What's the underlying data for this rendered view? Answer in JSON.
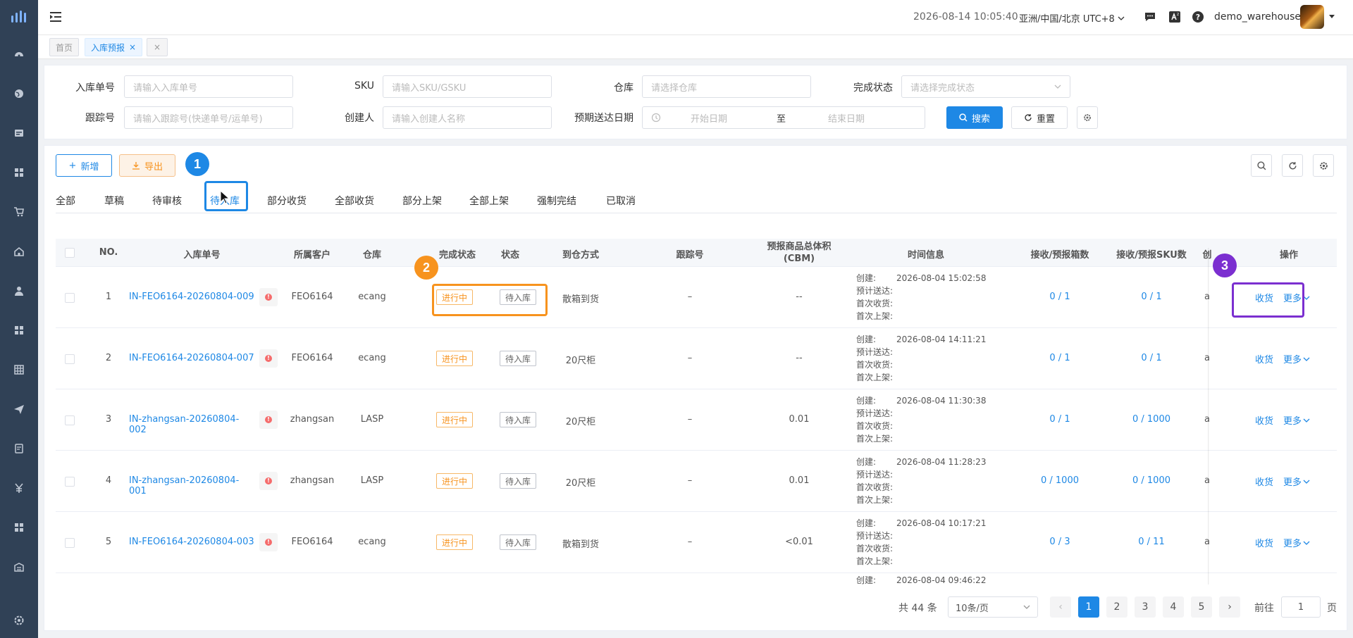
{
  "topbar": {
    "datetime": "2026-08-14 10:05:40",
    "timezone": "亚洲/中国/北京 UTC+8",
    "username": "demo_warehouse"
  },
  "tags": [
    {
      "label": "首页"
    },
    {
      "label": "入库预报"
    }
  ],
  "filters": {
    "inbound_no": {
      "label": "入库单号",
      "placeholder": "请输入入库单号"
    },
    "sku": {
      "label": "SKU",
      "placeholder": "请输入SKU/GSKU"
    },
    "warehouse": {
      "label": "仓库",
      "placeholder": "请选择仓库"
    },
    "finish_status": {
      "label": "完成状态",
      "placeholder": "请选择完成状态"
    },
    "tracking": {
      "label": "跟踪号",
      "placeholder": "请输入跟踪号(快递单号/运单号)"
    },
    "creator": {
      "label": "创建人",
      "placeholder": "请输入创建人名称"
    },
    "eta": {
      "label": "预期送达日期",
      "start": "开始日期",
      "to": "至",
      "end": "结束日期"
    },
    "search_label": "搜索",
    "reset_label": "重置"
  },
  "toolbar": {
    "add_label": "新增",
    "export_label": "导出"
  },
  "tabs": [
    "全部",
    "草稿",
    "待审核",
    "待入库",
    "部分收货",
    "全部收货",
    "部分上架",
    "全部上架",
    "强制完结",
    "已取消"
  ],
  "active_tab": "待入库",
  "annotations": {
    "badge1": "1",
    "badge2": "2",
    "badge3": "3"
  },
  "table": {
    "headers": {
      "no": "NO.",
      "inbound_no": "入库单号",
      "customer": "所属客户",
      "warehouse": "仓库",
      "finish_status": "完成状态",
      "status": "状态",
      "arrival": "到仓方式",
      "tracking": "跟踪号",
      "volume_l1": "预报商品总体积",
      "volume_l2": "(CBM)",
      "time": "时间信息",
      "boxes": "接收/预报箱数",
      "skus": "接收/预报SKU数",
      "partial": "创",
      "ops": "操作"
    },
    "time_labels": {
      "created": "创建:",
      "eta": "预计送达:",
      "first_receive": "首次收货:",
      "first_shelf": "首次上架:"
    },
    "rows": [
      {
        "no": "1",
        "inbound_no": "IN-FEO6164-20260804-009",
        "customer": "FEO6164",
        "warehouse": "ecang",
        "finish_status": "进行中",
        "status": "待入库",
        "arrival": "散箱到货",
        "tracking": "–",
        "volume": "--",
        "created": "2026-08-04 15:02:58",
        "boxes": "0 / 1",
        "skus": "0 / 1",
        "partial": "a",
        "receive": "收货",
        "more": "更多"
      },
      {
        "no": "2",
        "inbound_no": "IN-FEO6164-20260804-007",
        "customer": "FEO6164",
        "warehouse": "ecang",
        "finish_status": "进行中",
        "status": "待入库",
        "arrival": "20尺柜",
        "tracking": "–",
        "volume": "--",
        "created": "2026-08-04 14:11:21",
        "boxes": "0 / 1",
        "skus": "0 / 1",
        "partial": "a",
        "receive": "收货",
        "more": "更多"
      },
      {
        "no": "3",
        "inbound_no": "IN-zhangsan-20260804-002",
        "customer": "zhangsan",
        "warehouse": "LASP",
        "finish_status": "进行中",
        "status": "待入库",
        "arrival": "20尺柜",
        "tracking": "–",
        "volume": "0.01",
        "created": "2026-08-04 11:30:38",
        "boxes": "0 / 1",
        "skus": "0 / 1000",
        "partial": "a",
        "receive": "收货",
        "more": "更多"
      },
      {
        "no": "4",
        "inbound_no": "IN-zhangsan-20260804-001",
        "customer": "zhangsan",
        "warehouse": "LASP",
        "finish_status": "进行中",
        "status": "待入库",
        "arrival": "20尺柜",
        "tracking": "–",
        "volume": "0.01",
        "created": "2026-08-04 11:28:23",
        "boxes": "0 / 1000",
        "skus": "0 / 1000",
        "partial": "a",
        "receive": "收货",
        "more": "更多"
      },
      {
        "no": "5",
        "inbound_no": "IN-FEO6164-20260804-003",
        "customer": "FEO6164",
        "warehouse": "ecang",
        "finish_status": "进行中",
        "status": "待入库",
        "arrival": "散箱到货",
        "tracking": "–",
        "volume": "<0.01",
        "created": "2026-08-04 10:17:21",
        "boxes": "0 / 3",
        "skus": "0 / 11",
        "partial": "a",
        "receive": "收货",
        "more": "更多"
      }
    ],
    "partial_row": {
      "created_label": "创建:",
      "created": "2026-08-04 09:46:22"
    }
  },
  "pagination": {
    "total": "共 44 条",
    "page_size": "10条/页",
    "pages": [
      "1",
      "2",
      "3",
      "4",
      "5"
    ],
    "current": "1",
    "goto_label": "前往",
    "goto_value": "1",
    "page_suffix": "页"
  }
}
